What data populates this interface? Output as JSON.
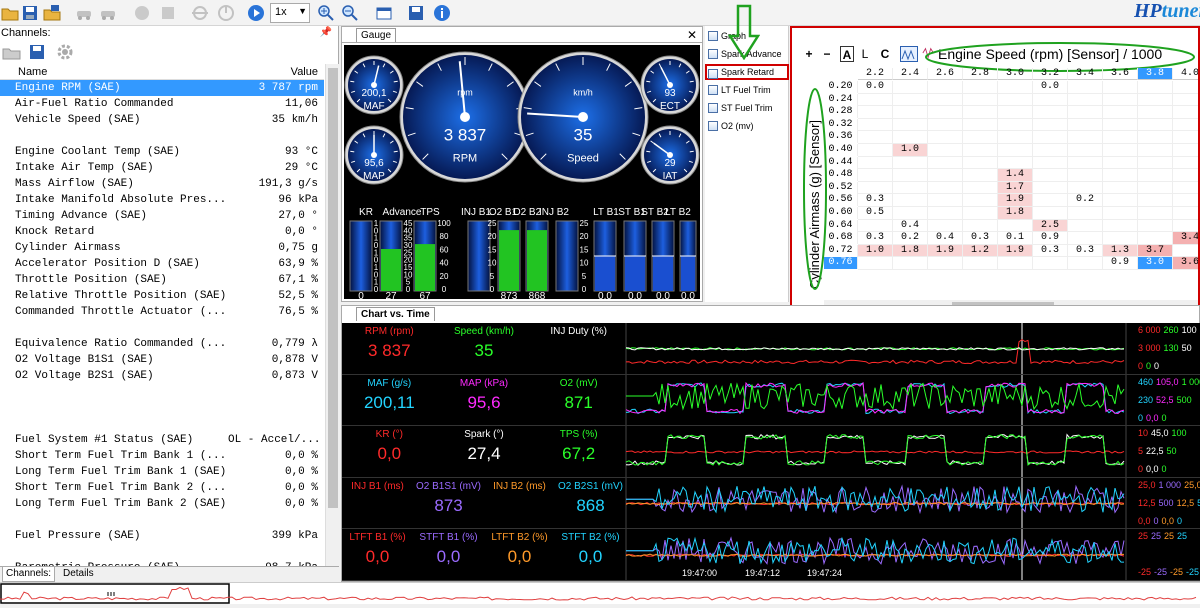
{
  "toolbar": {
    "speed_select": "1x",
    "brand_main": "HP",
    "brand_rest": "tuners"
  },
  "channels": {
    "header": "Channels:",
    "col_name": "Name",
    "col_value": "Value",
    "rows": [
      {
        "name": "Engine RPM (SAE)",
        "value": "3 787 rpm",
        "selected": true
      },
      {
        "name": "Air-Fuel Ratio Commanded",
        "value": "11,06"
      },
      {
        "name": "Vehicle Speed (SAE)",
        "value": "35 km/h"
      },
      {
        "name": "",
        "value": ""
      },
      {
        "name": "Engine Coolant Temp (SAE)",
        "value": "93 °C"
      },
      {
        "name": "Intake Air Temp (SAE)",
        "value": "29 °C"
      },
      {
        "name": "Mass Airflow (SAE)",
        "value": "191,3 g/s"
      },
      {
        "name": "Intake Manifold Absolute Pres...",
        "value": "96 kPa"
      },
      {
        "name": "Timing Advance (SAE)",
        "value": "27,0 °"
      },
      {
        "name": "Knock Retard",
        "value": "0,0 °"
      },
      {
        "name": "Cylinder Airmass",
        "value": "0,75 g"
      },
      {
        "name": "Accelerator Position D (SAE)",
        "value": "63,9 %"
      },
      {
        "name": "Throttle Position (SAE)",
        "value": "67,1 %"
      },
      {
        "name": "Relative Throttle Position (SAE)",
        "value": "52,5 %"
      },
      {
        "name": "Commanded Throttle Actuator (...",
        "value": "76,5 %"
      },
      {
        "name": "",
        "value": ""
      },
      {
        "name": "Equivalence Ratio Commanded (...",
        "value": "0,779 λ"
      },
      {
        "name": "O2 Voltage B1S1 (SAE)",
        "value": "0,878 V"
      },
      {
        "name": "O2 Voltage B2S1 (SAE)",
        "value": "0,873 V"
      },
      {
        "name": "",
        "value": ""
      },
      {
        "name": "",
        "value": ""
      },
      {
        "name": "",
        "value": ""
      },
      {
        "name": "Fuel System #1 Status (SAE)",
        "value": "OL - Accel/..."
      },
      {
        "name": "Short Term Fuel Trim Bank 1 (...",
        "value": "0,0 %"
      },
      {
        "name": "Long Term Fuel Trim Bank 1 (SAE)",
        "value": "0,0 %"
      },
      {
        "name": "Short Term Fuel Trim Bank 2 (...",
        "value": "0,0 %"
      },
      {
        "name": "Long Term Fuel Trim Bank 2 (SAE)",
        "value": "0,0 %"
      },
      {
        "name": "",
        "value": ""
      },
      {
        "name": "Fuel Pressure (SAE)",
        "value": "399 kPa"
      },
      {
        "name": "",
        "value": ""
      },
      {
        "name": "Barometric Pressure (SAE)",
        "value": "98,7 kPa"
      }
    ],
    "tabs": [
      "Channels:",
      "Details"
    ]
  },
  "gauge_panel": {
    "tab": "Gauge",
    "small_gauges": [
      {
        "label": "MAF",
        "value": "200,1"
      },
      {
        "label": "MAP",
        "value": "95,6"
      },
      {
        "label": "ECT",
        "value": "93"
      },
      {
        "label": "IAT",
        "value": "29"
      }
    ],
    "big_gauges": [
      {
        "label": "RPM",
        "unit": "rpm",
        "value": "3 837",
        "fraction": 0.48
      },
      {
        "label": "Speed",
        "unit": "km/h",
        "value": "35",
        "fraction": 0.18
      }
    ],
    "bars": [
      {
        "label": "KR",
        "value": "0",
        "fill": 0.0,
        "color": "#1a4fd0"
      },
      {
        "label": "Advance",
        "value": "27",
        "fill": 0.6,
        "color": "#22c422"
      },
      {
        "label": "TPS",
        "value": "67",
        "fill": 0.67,
        "color": "#22c422"
      },
      {
        "label": "INJ B1",
        "value": "",
        "fill": 0.0,
        "color": "#1a4fd0"
      },
      {
        "label": "O2 B1",
        "value": "873",
        "fill": 0.87,
        "color": "#22c422"
      },
      {
        "label": "O2 B2",
        "value": "868",
        "fill": 0.87,
        "color": "#22c422"
      },
      {
        "label": "INJ B2",
        "value": "",
        "fill": 0.0,
        "color": "#1a4fd0"
      },
      {
        "label": "LT B1",
        "value": "0,0",
        "fill": 0.5,
        "color": "#1a4fd0"
      },
      {
        "label": "ST B1",
        "value": "0,0",
        "fill": 0.5,
        "color": "#1a4fd0"
      },
      {
        "label": "ST B2",
        "value": "0,0",
        "fill": 0.5,
        "color": "#1a4fd0"
      },
      {
        "label": "LT B2",
        "value": "0,0",
        "fill": 0.5,
        "color": "#1a4fd0"
      }
    ],
    "scale_a": [
      "1",
      "0",
      "1",
      "0",
      "1",
      "0",
      "1",
      "0",
      "1",
      "0"
    ],
    "scale_b": [
      "45",
      "40",
      "35",
      "30",
      "25",
      "20",
      "15",
      "10",
      "5",
      "0"
    ],
    "scale_c": [
      "100",
      "80",
      "60",
      "40",
      "20",
      "0"
    ],
    "scale_d": [
      "25",
      "20",
      "15",
      "10",
      "5",
      "0"
    ]
  },
  "side_menu": {
    "items": [
      "Graph",
      "Spark Advance",
      "Spark Retard",
      "LT Fuel Trim",
      "ST Fuel Trim",
      "O2 (mv)"
    ],
    "highlighted": "Spark Retard"
  },
  "table_panel": {
    "tools": [
      "+",
      "−",
      "A",
      "L",
      "C"
    ],
    "title": "Engine Speed (rpm) [Sensor] / 1000",
    "y_label": "Cylinder Airmass (g) [Sensor]",
    "columns": [
      "2.2",
      "2.4",
      "2.6",
      "2.8",
      "3.0",
      "3.2",
      "3.4",
      "3.6",
      "3.8",
      "4.0"
    ],
    "rows": [
      {
        "y": "0.20",
        "cells": [
          "0.0",
          "",
          "",
          "",
          "",
          "0.0",
          "",
          "",
          "",
          ""
        ]
      },
      {
        "y": "0.24",
        "cells": [
          "",
          "",
          "",
          "",
          "",
          "",
          "",
          "",
          "",
          ""
        ]
      },
      {
        "y": "0.28",
        "cells": [
          "",
          "",
          "",
          "",
          "",
          "",
          "",
          "",
          "",
          ""
        ]
      },
      {
        "y": "0.32",
        "cells": [
          "",
          "",
          "",
          "",
          "",
          "",
          "",
          "",
          "",
          ""
        ]
      },
      {
        "y": "0.36",
        "cells": [
          "",
          "",
          "",
          "",
          "",
          "",
          "",
          "",
          "",
          ""
        ]
      },
      {
        "y": "0.40",
        "cells": [
          "",
          "1.0",
          "",
          "",
          "",
          "",
          "",
          "",
          "",
          ""
        ]
      },
      {
        "y": "0.44",
        "cells": [
          "",
          "",
          "",
          "",
          "",
          "",
          "",
          "",
          "",
          ""
        ]
      },
      {
        "y": "0.48",
        "cells": [
          "",
          "",
          "",
          "",
          "1.4",
          "",
          "",
          "",
          "",
          ""
        ]
      },
      {
        "y": "0.52",
        "cells": [
          "",
          "",
          "",
          "",
          "1.7",
          "",
          "",
          "",
          "",
          ""
        ]
      },
      {
        "y": "0.56",
        "cells": [
          "0.3",
          "",
          "",
          "",
          "1.9",
          "",
          "0.2",
          "",
          "",
          ""
        ]
      },
      {
        "y": "0.60",
        "cells": [
          "0.5",
          "",
          "",
          "",
          "1.8",
          "",
          "",
          "",
          "",
          ""
        ]
      },
      {
        "y": "0.64",
        "cells": [
          "",
          "0.4",
          "",
          "",
          "",
          "2.5",
          "",
          "",
          "",
          ""
        ]
      },
      {
        "y": "0.68",
        "cells": [
          "0.3",
          "0.2",
          "0.4",
          "0.3",
          "0.1",
          "0.9",
          "",
          "",
          "",
          "3.4"
        ]
      },
      {
        "y": "0.72",
        "cells": [
          "1.0",
          "1.8",
          "1.9",
          "1.2",
          "1.9",
          "0.3",
          "0.3",
          "1.3",
          "3.7",
          ""
        ]
      },
      {
        "y": "0.76",
        "cells": [
          "",
          "",
          "",
          "",
          "",
          "",
          "",
          "0.9",
          "3.0",
          "3.6"
        ]
      }
    ]
  },
  "chart_panel": {
    "tab": "Chart vs. Time",
    "lanes": [
      {
        "channels": [
          {
            "label": "RPM (rpm)",
            "value": "3 837",
            "color": "#ff2a2a"
          },
          {
            "label": "Speed (km/h)",
            "value": "35",
            "color": "#2aff2a"
          },
          {
            "label": "INJ Duty (%)",
            "value": "",
            "color": "#ffffff"
          }
        ],
        "scale_top": [
          "6 000",
          "260",
          "100"
        ],
        "scale_mid": [
          "3 000",
          "130",
          "50"
        ],
        "scale_bot": [
          "0",
          "0",
          "0"
        ]
      },
      {
        "channels": [
          {
            "label": "MAF (g/s)",
            "value": "200,11",
            "color": "#22d4ff"
          },
          {
            "label": "MAP (kPa)",
            "value": "95,6",
            "color": "#ff2aff"
          },
          {
            "label": "O2 (mV)",
            "value": "871",
            "color": "#2aff2a"
          }
        ],
        "scale_top": [
          "460",
          "105,0",
          "1 000"
        ],
        "scale_mid": [
          "230",
          "52,5",
          "500"
        ],
        "scale_bot": [
          "0",
          "0,0",
          "0"
        ]
      },
      {
        "channels": [
          {
            "label": "KR (°)",
            "value": "0,0",
            "color": "#ff2a2a"
          },
          {
            "label": "Spark (°)",
            "value": "27,4",
            "color": "#ffffff"
          },
          {
            "label": "TPS (%)",
            "value": "67,2",
            "color": "#2aff2a"
          }
        ],
        "scale_top": [
          "10",
          "45,0",
          "100"
        ],
        "scale_mid": [
          "5",
          "22,5",
          "50"
        ],
        "scale_bot": [
          "0",
          "0,0",
          "0"
        ]
      },
      {
        "channels": [
          {
            "label": "INJ B1 (ms)",
            "value": "",
            "color": "#ff2a2a"
          },
          {
            "label": "O2 B1S1 (mV)",
            "value": "873",
            "color": "#9b6bff"
          },
          {
            "label": "INJ B2 (ms)",
            "value": "",
            "color": "#ff9a2a"
          },
          {
            "label": "O2 B2S1 (mV)",
            "value": "868",
            "color": "#22d4ff"
          }
        ],
        "scale_top": [
          "25,0",
          "1 000",
          "25,0",
          "1 000"
        ],
        "scale_mid": [
          "12,5",
          "500",
          "12,5",
          "500"
        ],
        "scale_bot": [
          "0,0",
          "0",
          "0,0",
          "0"
        ]
      },
      {
        "channels": [
          {
            "label": "LTFT B1 (%)",
            "value": "0,0",
            "color": "#ff2a2a"
          },
          {
            "label": "STFT B1 (%)",
            "value": "0,0",
            "color": "#9b6bff"
          },
          {
            "label": "LTFT B2 (%)",
            "value": "0,0",
            "color": "#ff9a2a"
          },
          {
            "label": "STFT B2 (%)",
            "value": "0,0",
            "color": "#22d4ff"
          }
        ],
        "scale_top": [
          "25",
          "25",
          "25",
          "25"
        ],
        "scale_mid": [],
        "scale_bot": [
          "-25",
          "-25",
          "-25",
          "-25"
        ]
      }
    ],
    "time_ticks": [
      "19:47:00",
      "19:47:12",
      "19:47:24"
    ]
  }
}
